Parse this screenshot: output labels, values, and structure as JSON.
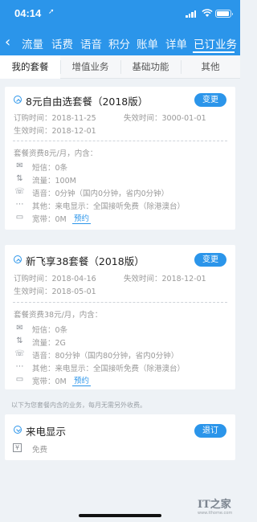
{
  "status": {
    "time": "04:14",
    "location": "➚"
  },
  "nav": {
    "back": "‹",
    "items": [
      "流量",
      "话费",
      "语音",
      "积分",
      "账单",
      "详单",
      "已订业务"
    ]
  },
  "tabs": [
    "我的套餐",
    "增值业务",
    "基础功能",
    "其他"
  ],
  "plans": [
    {
      "title": "8元自由选套餐（2018版）",
      "action": "变更",
      "order_label": "订购时间：2018-11-25",
      "expire_label": "失效时间：3000-01-01",
      "effective_label": "生效时间：2018-12-01",
      "fee": "套餐资费8元/月，内含：",
      "items": [
        {
          "icon": "✉",
          "text": "短信：0条"
        },
        {
          "icon": "⇅",
          "text": "流量：100M"
        },
        {
          "icon": "☏",
          "text": "语音：0分钟（国内0分钟，省内0分钟）"
        },
        {
          "icon": "⋯",
          "text": "其他：来电显示：全国接听免费（除港澳台）"
        },
        {
          "icon": "▭",
          "text": "宽带：0M",
          "link": "预约"
        }
      ]
    },
    {
      "title": "新飞享38套餐（2018版）",
      "action": "变更",
      "order_label": "订购时间：2018-04-16",
      "expire_label": "失效时间：2018-12-01",
      "effective_label": "生效时间：2018-05-01",
      "fee": "套餐资费38元/月，内含：",
      "items": [
        {
          "icon": "✉",
          "text": "短信：0条"
        },
        {
          "icon": "⇅",
          "text": "流量：2G"
        },
        {
          "icon": "☏",
          "text": "语音：80分钟（国内80分钟，省内0分钟）"
        },
        {
          "icon": "⋯",
          "text": "其他：来电显示：全国接听免费（除港澳台）"
        },
        {
          "icon": "▭",
          "text": "宽带：0M",
          "link": "预约"
        }
      ]
    }
  ],
  "note": "以下为您套餐内含的业务，每月无需另外收费。",
  "included": {
    "title": "来电显示",
    "action": "退订",
    "icon": "¥",
    "price": "免费"
  },
  "watermark": {
    "main": "IT之家",
    "sub": "www.ithome.com"
  },
  "colors": {
    "accent": "#2b95ea",
    "background": "#eef2f6"
  }
}
